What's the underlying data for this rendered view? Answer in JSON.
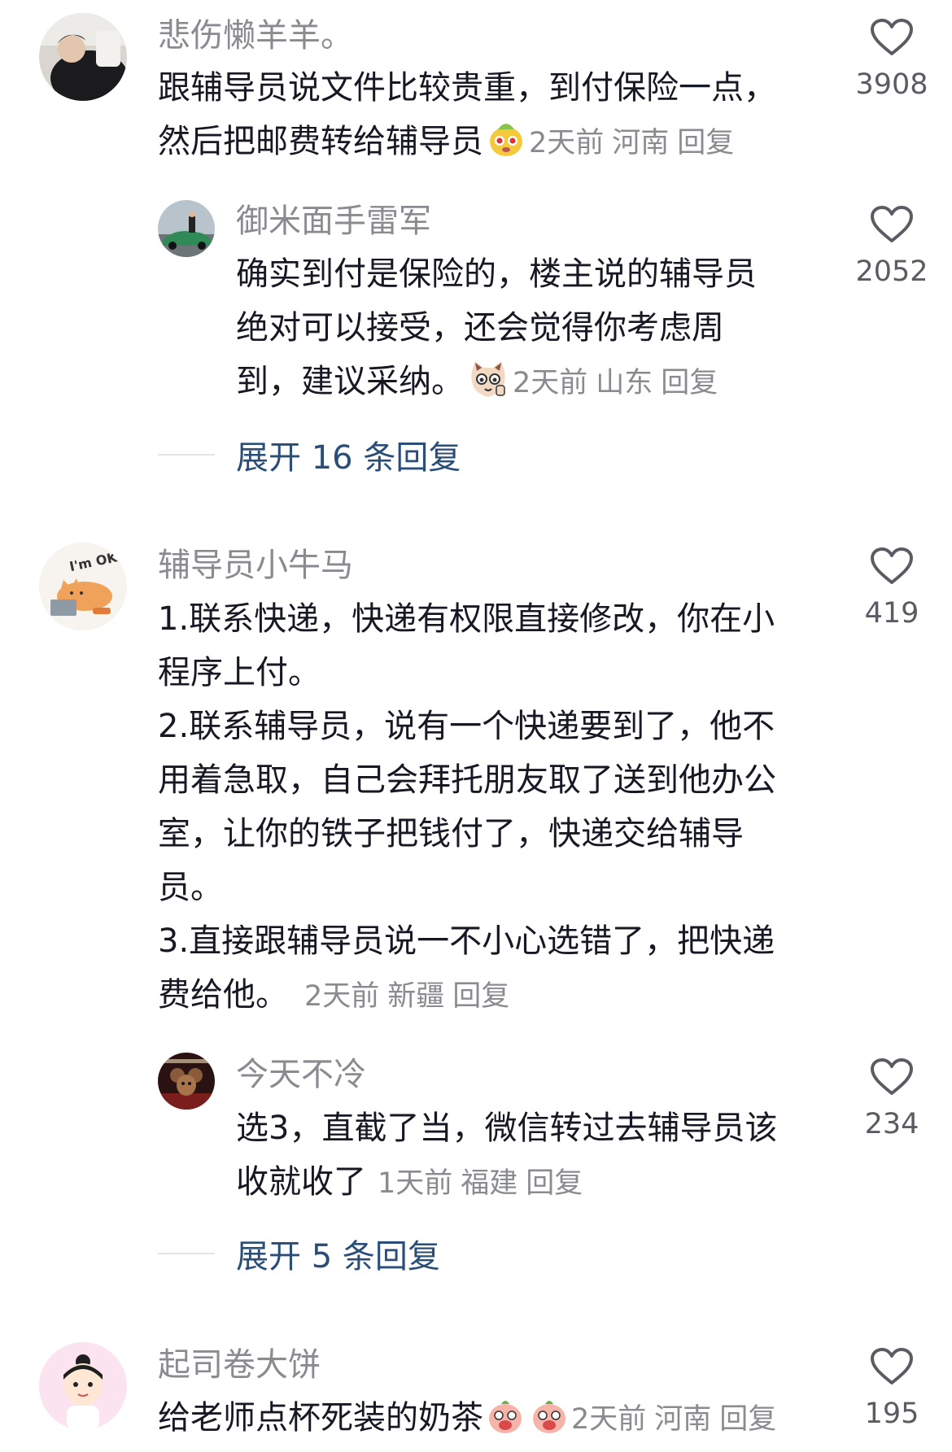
{
  "comments": [
    {
      "username": "悲伤懒羊羊。",
      "lines": [
        "跟辅导员说文件比较贵重，到付保险一点，",
        "然后把邮费转给辅导员"
      ],
      "time": "2天前",
      "location": "河南",
      "reply_label": "回复",
      "likes": "3908",
      "avatar_icon": "user-photo-icon",
      "emoji": "melon-face-emoji",
      "replies": [
        {
          "username": "御米面手雷军",
          "lines": [
            "确实到付是保险的，楼主说的辅导员",
            "绝对可以接受，还会觉得你考虑周",
            "到，建议采纳。"
          ],
          "time": "2天前",
          "location": "山东",
          "reply_label": "回复",
          "likes": "2052",
          "avatar_icon": "car-photo-icon",
          "emoji": "smug-cat-emoji"
        }
      ],
      "expand_label": "展开 16 条回复"
    },
    {
      "username": "辅导员小牛马",
      "lines": [
        "1.联系快递，快递有权限直接修改，你在小",
        "程序上付。",
        "2.联系辅导员，说有一个快递要到了，他不",
        "用着急取，自己会拜托朋友取了送到他办公",
        "室，让你的铁子把钱付了，快递交给辅导",
        "员。",
        "3.直接跟辅导员说一不小心选错了，把快递",
        "费给他。"
      ],
      "time": "2天前",
      "location": "新疆",
      "reply_label": "回复",
      "likes": "419",
      "avatar_icon": "cat-im-ok-icon",
      "avatar_text": "I'm OK!",
      "replies": [
        {
          "username": "今天不冷",
          "lines": [
            "选3，直截了当，微信转过去辅导员该",
            "收就收了"
          ],
          "time": "1天前",
          "location": "福建",
          "reply_label": "回复",
          "likes": "234",
          "avatar_icon": "cartoon-mouse-icon"
        }
      ],
      "expand_label": "展开 5 条回复"
    },
    {
      "username": "起司卷大饼",
      "lines": [
        "给老师点杯死装的奶茶"
      ],
      "time": "2天前",
      "location": "河南",
      "reply_label": "回复",
      "likes": "195",
      "avatar_icon": "cartoon-girl-icon",
      "emoji": "drooling-peach-emoji"
    }
  ],
  "colors": {
    "text": "#161823",
    "meta": "#8a8b91",
    "expand_link": "#2a4e78",
    "heart_outline": "#5b5c63"
  }
}
